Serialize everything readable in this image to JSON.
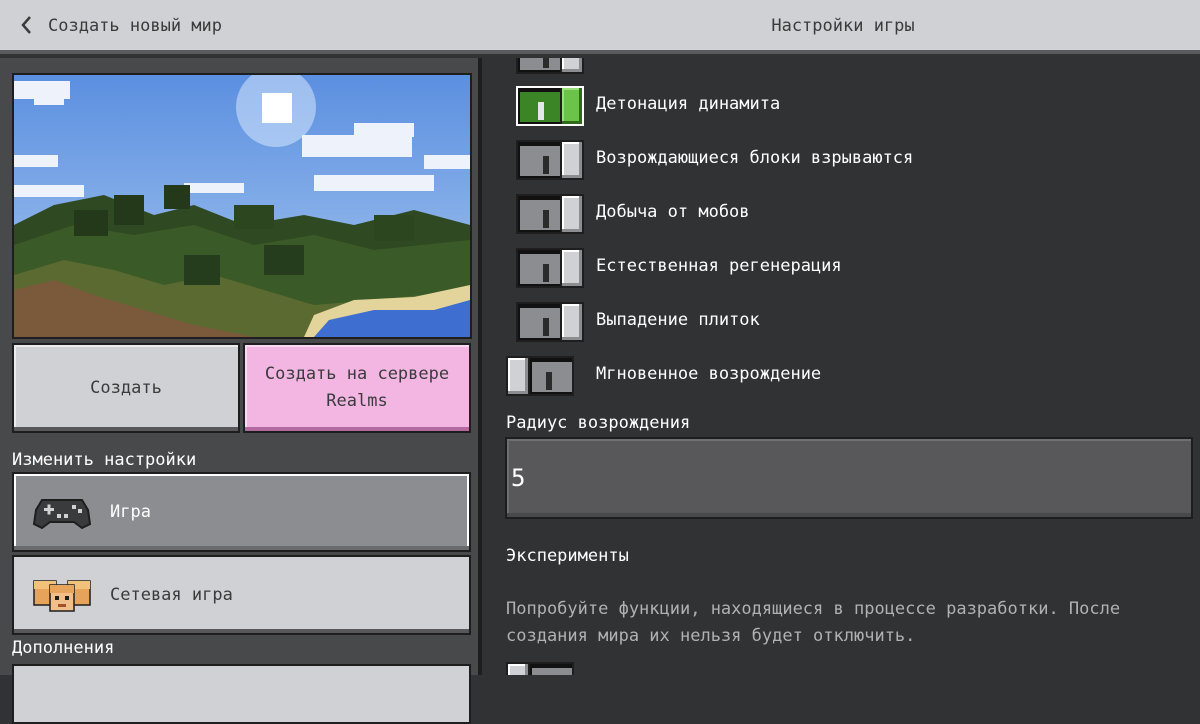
{
  "header": {
    "back_label": "Создать новый мир",
    "title": "Настройки игры"
  },
  "left": {
    "create_label": "Создать",
    "realms_label": "Создать на сервере Realms",
    "settings_heading": "Изменить настройки",
    "nav_game_label": "Игра",
    "nav_multiplayer_label": "Сетевая игра",
    "addons_heading": "Дополнения"
  },
  "toggles": [
    {
      "label": "",
      "state": "off",
      "partial": true
    },
    {
      "label": "Детонация динамита",
      "state": "on"
    },
    {
      "label": "Возрождающиеся блоки взрываются",
      "state": "off"
    },
    {
      "label": "Добыча от мобов",
      "state": "off"
    },
    {
      "label": "Естественная регенерация",
      "state": "off"
    },
    {
      "label": "Выпадение плиток",
      "state": "off"
    },
    {
      "label": "Мгновенное возрождение",
      "state": "off-left"
    }
  ],
  "respawn": {
    "label": "Радиус возрождения",
    "value": "5"
  },
  "experiments": {
    "title": "Эксперименты",
    "description": "Попробуйте функции, находящиеся в процессе разработки. После создания мира их нельзя будет отключить."
  },
  "colors": {
    "toggle_on": "#3c8527",
    "realms_button": "#f3b6e3",
    "header_bg": "#d0d1d4"
  }
}
